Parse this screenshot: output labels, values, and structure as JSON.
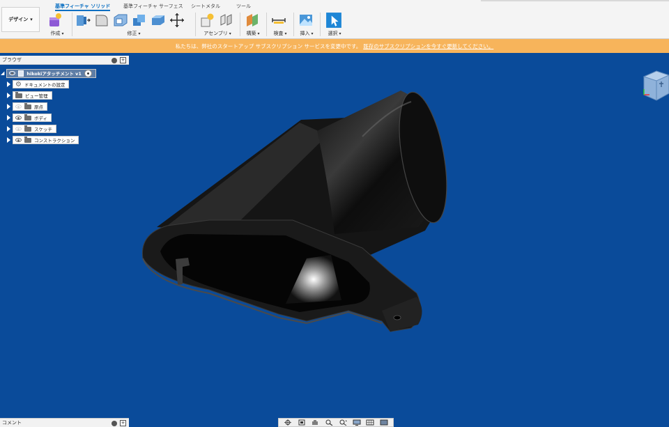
{
  "toolbar": {
    "workspace": "デザイン",
    "tabs": [
      "基準フィーチャ ソリッド",
      "基準フィーチャ サーフェス",
      "シートメタル",
      "ツール"
    ],
    "groups": {
      "create": "作成",
      "modify": "修正",
      "assemble": "アセンブリ",
      "construct": "構築",
      "inspect": "検査",
      "insert": "挿入",
      "select": "選択"
    }
  },
  "banner": {
    "text": "私たちは、弊社のスタートアップ サブスクリプション サービスを変更中です。",
    "link": "既存のサブスクリプションを今すぐ更新してください。"
  },
  "browser": {
    "title": "ブラウザ",
    "root": "hikokiアタッチメント v1",
    "items": [
      "ドキュメントの設定",
      "ビュー管理",
      "原点",
      "ボディ",
      "スケッチ",
      "コンストラクション"
    ]
  },
  "comments": {
    "title": "コメント"
  },
  "colors": {
    "accent": "#0a6fc2",
    "banner": "#f7b45b",
    "viewport": "#0a4b9a"
  }
}
